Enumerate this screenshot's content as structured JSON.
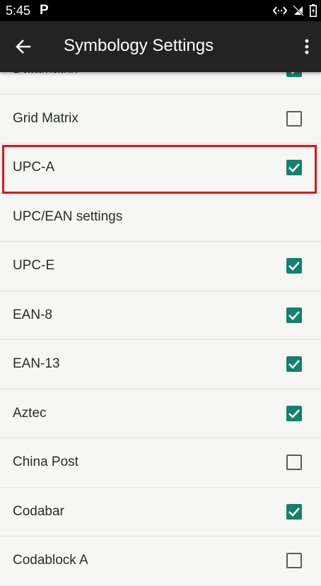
{
  "status_bar": {
    "time": "5:45",
    "notification": "P"
  },
  "app_bar": {
    "title": "Symbology Settings"
  },
  "list": {
    "items": [
      {
        "label": "Datamatrix",
        "checked": true,
        "has_checkbox": true
      },
      {
        "label": "Grid Matrix",
        "checked": false,
        "has_checkbox": true
      },
      {
        "label": "UPC-A",
        "checked": true,
        "has_checkbox": true
      },
      {
        "label": "UPC/EAN settings",
        "checked": false,
        "has_checkbox": false
      },
      {
        "label": "UPC-E",
        "checked": true,
        "has_checkbox": true
      },
      {
        "label": "EAN-8",
        "checked": true,
        "has_checkbox": true
      },
      {
        "label": "EAN-13",
        "checked": true,
        "has_checkbox": true
      },
      {
        "label": "Aztec",
        "checked": true,
        "has_checkbox": true
      },
      {
        "label": "China Post",
        "checked": false,
        "has_checkbox": true
      },
      {
        "label": "Codabar",
        "checked": true,
        "has_checkbox": true
      },
      {
        "label": "Codablock A",
        "checked": false,
        "has_checkbox": true
      }
    ]
  },
  "colors": {
    "accent": "#14806f",
    "highlight": "#e0141a",
    "app_bar": "#222322"
  }
}
